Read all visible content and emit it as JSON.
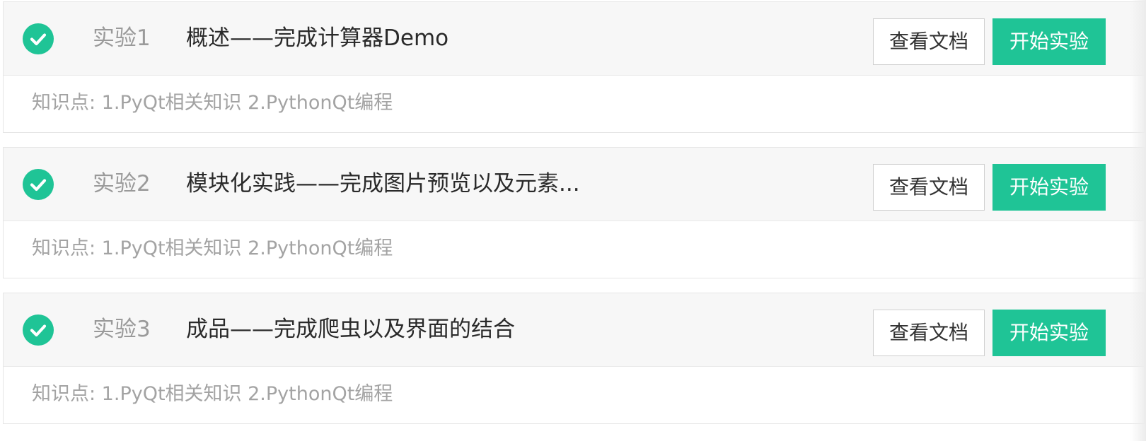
{
  "colors": {
    "accent": "#1fc496",
    "header_bg": "#f7f7f7",
    "muted_text": "#9a9a9a"
  },
  "experiments": [
    {
      "status_icon": "check-circle-icon",
      "number": "实验1",
      "title": "概述——完成计算器Demo",
      "doc_button": "查看文档",
      "start_button": "开始实验",
      "knowledge": "知识点: 1.PyQt相关知识 2.PythonQt编程"
    },
    {
      "status_icon": "check-circle-icon",
      "number": "实验2",
      "title": "模块化实践——完成图片预览以及元素...",
      "doc_button": "查看文档",
      "start_button": "开始实验",
      "knowledge": "知识点: 1.PyQt相关知识 2.PythonQt编程"
    },
    {
      "status_icon": "check-circle-icon",
      "number": "实验3",
      "title": "成品——完成爬虫以及界面的结合",
      "doc_button": "查看文档",
      "start_button": "开始实验",
      "knowledge": "知识点: 1.PyQt相关知识 2.PythonQt编程"
    }
  ]
}
